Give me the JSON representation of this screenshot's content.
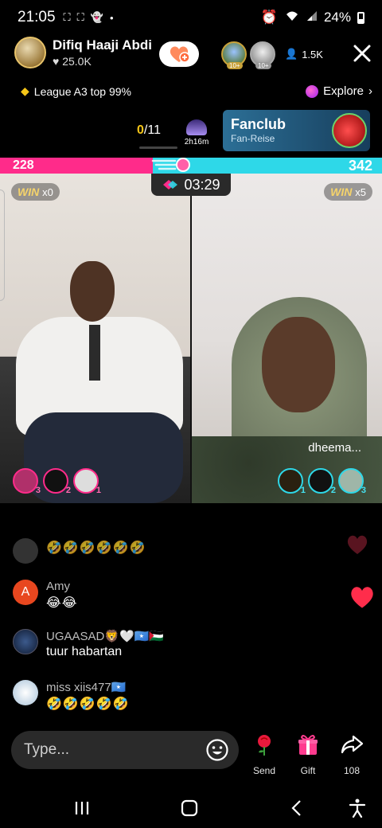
{
  "status_bar": {
    "time": "21:05",
    "battery": "24%",
    "left_icons": [
      "screen-icon",
      "screen-icon",
      "snapchat-icon",
      "dot"
    ],
    "right_icons": [
      "alarm-icon",
      "wifi-icon",
      "signal-icon",
      "battery-icon"
    ]
  },
  "host": {
    "name": "Difiq Haaji Abdi",
    "likes": "25.0K"
  },
  "top_viewers": [
    {
      "badge": "10+"
    },
    {
      "badge": "10+"
    }
  ],
  "viewer_count": "1.5K",
  "league": {
    "text": "League A3 top 99%"
  },
  "explore": {
    "label": "Explore"
  },
  "goal": {
    "current": "0",
    "total": "/11",
    "timer": "2h16m"
  },
  "fanclub": {
    "title": "Fanclub",
    "subtitle": "Fan-Reise"
  },
  "battle": {
    "left_score": "228",
    "right_score": "342",
    "left_score_fraction": 0.4,
    "timer": "03:29",
    "left_win_label": "WIN",
    "left_win_count": "x0",
    "right_win_label": "WIN",
    "right_win_count": "x5",
    "guest_name": "dheema...",
    "left_gifters": [
      {
        "rank": "3"
      },
      {
        "rank": "2"
      },
      {
        "rank": "1"
      }
    ],
    "right_gifters": [
      {
        "rank": "1"
      },
      {
        "rank": "2"
      },
      {
        "rank": "3"
      }
    ]
  },
  "comments": [
    {
      "user": "",
      "text": "🤣🤣🤣🤣🤣🤣",
      "avatar_initial": "",
      "avatar_color": "#444444"
    },
    {
      "user": "Amy",
      "text": "😂😂",
      "avatar_initial": "A",
      "avatar_color": "#e8471f"
    },
    {
      "user": "UGAASAD🦁🤍🇸🇴🇵🇸",
      "text": "tuur habartan",
      "avatar_initial": "",
      "avatar_color": "#1b2a4a"
    },
    {
      "user": "miss xiis477🇸🇴",
      "text": "🤣🤣🤣🤣🤣",
      "avatar_initial": "",
      "avatar_color": "#d8e4ef"
    }
  ],
  "composer": {
    "placeholder": "Type..."
  },
  "actions": {
    "send_label": "Send",
    "gift_label": "Gift",
    "share_count": "108"
  },
  "colors": {
    "team_left": "#ff2b8a",
    "team_right": "#2ed8e8",
    "gold": "#f5c518"
  }
}
